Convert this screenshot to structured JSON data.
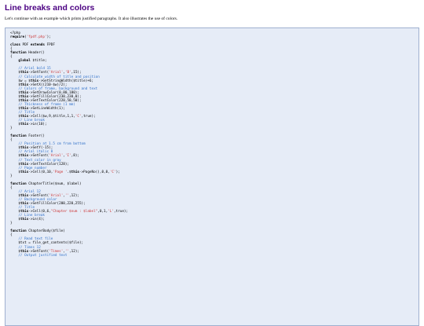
{
  "page": {
    "title": "Line breaks and colors",
    "intro": "Let's continue with an example which prints justified paragraphs. It also illustrates the use of colors."
  },
  "code": {
    "lines": [
      [
        {
          "t": "<?php",
          "c": ""
        }
      ],
      [
        {
          "t": "require",
          "c": "kw"
        },
        {
          "t": "(",
          "c": ""
        },
        {
          "t": "'fpdf.php'",
          "c": "str"
        },
        {
          "t": ");",
          "c": ""
        }
      ],
      [
        {
          "t": "",
          "c": ""
        }
      ],
      [
        {
          "t": "class",
          "c": "kw"
        },
        {
          "t": " PDF ",
          "c": ""
        },
        {
          "t": "extends",
          "c": "kw"
        },
        {
          "t": " FPDF",
          "c": ""
        }
      ],
      [
        {
          "t": "{",
          "c": ""
        }
      ],
      [
        {
          "t": "function",
          "c": "kw"
        },
        {
          "t": " Header()",
          "c": ""
        }
      ],
      [
        {
          "t": "{",
          "c": ""
        }
      ],
      [
        {
          "t": "    ",
          "c": ""
        },
        {
          "t": "global",
          "c": "kw"
        },
        {
          "t": " $title;",
          "c": ""
        }
      ],
      [
        {
          "t": "",
          "c": ""
        }
      ],
      [
        {
          "t": "    // Arial bold 15",
          "c": "cm"
        }
      ],
      [
        {
          "t": "    $",
          "c": ""
        },
        {
          "t": "this",
          "c": "kw"
        },
        {
          "t": "->SetFont(",
          "c": ""
        },
        {
          "t": "'Arial'",
          "c": "str"
        },
        {
          "t": ",",
          "c": ""
        },
        {
          "t": "'B'",
          "c": "str"
        },
        {
          "t": ",15);",
          "c": ""
        }
      ],
      [
        {
          "t": "    // Calculate width of title and position",
          "c": "cm"
        }
      ],
      [
        {
          "t": "    $w = $",
          "c": ""
        },
        {
          "t": "this",
          "c": "kw"
        },
        {
          "t": "->GetStringWidth($title)+6;",
          "c": ""
        }
      ],
      [
        {
          "t": "    $",
          "c": ""
        },
        {
          "t": "this",
          "c": "kw"
        },
        {
          "t": "->SetX((210-$w)/2);",
          "c": ""
        }
      ],
      [
        {
          "t": "    // Colors of frame, background and text",
          "c": "cm"
        }
      ],
      [
        {
          "t": "    $",
          "c": ""
        },
        {
          "t": "this",
          "c": "kw"
        },
        {
          "t": "->SetDrawColor(0,80,180);",
          "c": ""
        }
      ],
      [
        {
          "t": "    $",
          "c": ""
        },
        {
          "t": "this",
          "c": "kw"
        },
        {
          "t": "->SetFillColor(230,230,0);",
          "c": ""
        }
      ],
      [
        {
          "t": "    $",
          "c": ""
        },
        {
          "t": "this",
          "c": "kw"
        },
        {
          "t": "->SetTextColor(220,50,50);",
          "c": ""
        }
      ],
      [
        {
          "t": "    // Thickness of frame (1 mm)",
          "c": "cm"
        }
      ],
      [
        {
          "t": "    $",
          "c": ""
        },
        {
          "t": "this",
          "c": "kw"
        },
        {
          "t": "->SetLineWidth(1);",
          "c": ""
        }
      ],
      [
        {
          "t": "    // Title",
          "c": "cm"
        }
      ],
      [
        {
          "t": "    $",
          "c": ""
        },
        {
          "t": "this",
          "c": "kw"
        },
        {
          "t": "->Cell($w,9,$title,1,1,",
          "c": ""
        },
        {
          "t": "'C'",
          "c": "str"
        },
        {
          "t": ",true);",
          "c": ""
        }
      ],
      [
        {
          "t": "    // Line break",
          "c": "cm"
        }
      ],
      [
        {
          "t": "    $",
          "c": ""
        },
        {
          "t": "this",
          "c": "kw"
        },
        {
          "t": "->Ln(10);",
          "c": ""
        }
      ],
      [
        {
          "t": "}",
          "c": ""
        }
      ],
      [
        {
          "t": "",
          "c": ""
        }
      ],
      [
        {
          "t": "function",
          "c": "kw"
        },
        {
          "t": " Footer()",
          "c": ""
        }
      ],
      [
        {
          "t": "{",
          "c": ""
        }
      ],
      [
        {
          "t": "    // Position at 1.5 cm from bottom",
          "c": "cm"
        }
      ],
      [
        {
          "t": "    $",
          "c": ""
        },
        {
          "t": "this",
          "c": "kw"
        },
        {
          "t": "->SetY(-15);",
          "c": ""
        }
      ],
      [
        {
          "t": "    // Arial italic 8",
          "c": "cm"
        }
      ],
      [
        {
          "t": "    $",
          "c": ""
        },
        {
          "t": "this",
          "c": "kw"
        },
        {
          "t": "->SetFont(",
          "c": ""
        },
        {
          "t": "'Arial'",
          "c": "str"
        },
        {
          "t": ",",
          "c": ""
        },
        {
          "t": "'I'",
          "c": "str"
        },
        {
          "t": ",8);",
          "c": ""
        }
      ],
      [
        {
          "t": "    // Text color in gray",
          "c": "cm"
        }
      ],
      [
        {
          "t": "    $",
          "c": ""
        },
        {
          "t": "this",
          "c": "kw"
        },
        {
          "t": "->SetTextColor(128);",
          "c": ""
        }
      ],
      [
        {
          "t": "    // Page number",
          "c": "cm"
        }
      ],
      [
        {
          "t": "    $",
          "c": ""
        },
        {
          "t": "this",
          "c": "kw"
        },
        {
          "t": "->Cell(0,10,",
          "c": ""
        },
        {
          "t": "'Page '",
          "c": "str"
        },
        {
          "t": ".$",
          "c": ""
        },
        {
          "t": "this",
          "c": "kw"
        },
        {
          "t": "->PageNo(),0,0,",
          "c": ""
        },
        {
          "t": "'C'",
          "c": "str"
        },
        {
          "t": ");",
          "c": ""
        }
      ],
      [
        {
          "t": "}",
          "c": ""
        }
      ],
      [
        {
          "t": "",
          "c": ""
        }
      ],
      [
        {
          "t": "function",
          "c": "kw"
        },
        {
          "t": " ChapterTitle($num, $label)",
          "c": ""
        }
      ],
      [
        {
          "t": "{",
          "c": ""
        }
      ],
      [
        {
          "t": "    // Arial 12",
          "c": "cm"
        }
      ],
      [
        {
          "t": "    $",
          "c": ""
        },
        {
          "t": "this",
          "c": "kw"
        },
        {
          "t": "->SetFont(",
          "c": ""
        },
        {
          "t": "'Arial'",
          "c": "str"
        },
        {
          "t": ",",
          "c": ""
        },
        {
          "t": "''",
          "c": "str"
        },
        {
          "t": ",12);",
          "c": ""
        }
      ],
      [
        {
          "t": "    // Background color",
          "c": "cm"
        }
      ],
      [
        {
          "t": "    $",
          "c": ""
        },
        {
          "t": "this",
          "c": "kw"
        },
        {
          "t": "->SetFillColor(200,220,255);",
          "c": ""
        }
      ],
      [
        {
          "t": "    // Title",
          "c": "cm"
        }
      ],
      [
        {
          "t": "    $",
          "c": ""
        },
        {
          "t": "this",
          "c": "kw"
        },
        {
          "t": "->Cell(0,6,",
          "c": ""
        },
        {
          "t": "\"Chapter $num : $label\"",
          "c": "str"
        },
        {
          "t": ",0,1,",
          "c": ""
        },
        {
          "t": "'L'",
          "c": "str"
        },
        {
          "t": ",true);",
          "c": ""
        }
      ],
      [
        {
          "t": "    // Line break",
          "c": "cm"
        }
      ],
      [
        {
          "t": "    $",
          "c": ""
        },
        {
          "t": "this",
          "c": "kw"
        },
        {
          "t": "->Ln(4);",
          "c": ""
        }
      ],
      [
        {
          "t": "}",
          "c": ""
        }
      ],
      [
        {
          "t": "",
          "c": ""
        }
      ],
      [
        {
          "t": "function",
          "c": "kw"
        },
        {
          "t": " ChapterBody($file)",
          "c": ""
        }
      ],
      [
        {
          "t": "{",
          "c": ""
        }
      ],
      [
        {
          "t": "    // Read text file",
          "c": "cm"
        }
      ],
      [
        {
          "t": "    $txt = file_get_contents($file);",
          "c": ""
        }
      ],
      [
        {
          "t": "    // Times 12",
          "c": "cm"
        }
      ],
      [
        {
          "t": "    $",
          "c": ""
        },
        {
          "t": "this",
          "c": "kw"
        },
        {
          "t": "->SetFont(",
          "c": ""
        },
        {
          "t": "'Times'",
          "c": "str"
        },
        {
          "t": ",",
          "c": ""
        },
        {
          "t": "''",
          "c": "str"
        },
        {
          "t": ",12);",
          "c": ""
        }
      ],
      [
        {
          "t": "    // Output justified text",
          "c": "cm"
        }
      ]
    ]
  }
}
